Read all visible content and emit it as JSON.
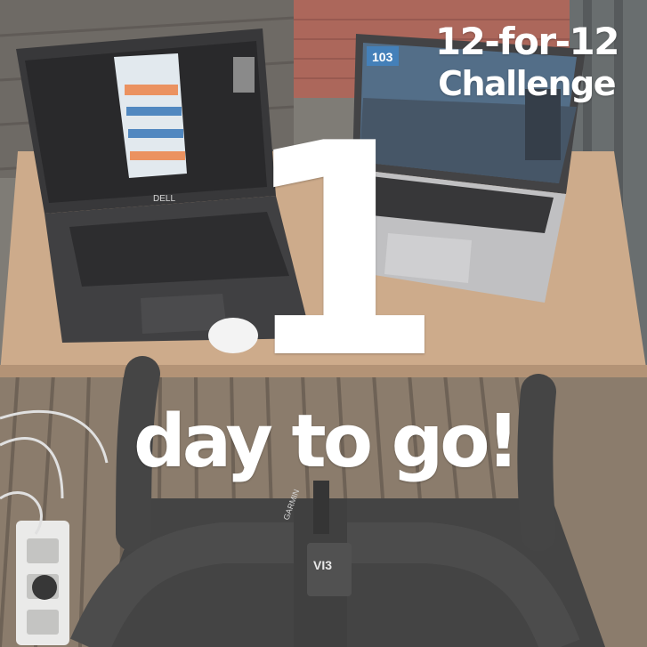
{
  "title": {
    "line1": "12-for-12",
    "line2": "Challenge"
  },
  "countdown": {
    "number": "1",
    "text": "day to go!"
  },
  "laptop_left": {
    "brand": "DELL"
  },
  "laptop_right": {
    "speed_readout": "103"
  },
  "bike_computer": {
    "brand": "GARMIN",
    "model": "VI3"
  },
  "colors": {
    "overlay_text": "#ffffff",
    "desk": "#c6a07c",
    "deck": "#7c6c5c",
    "handlebar_tape": "#2c2c2c",
    "orange_accent": "#e9834a"
  }
}
